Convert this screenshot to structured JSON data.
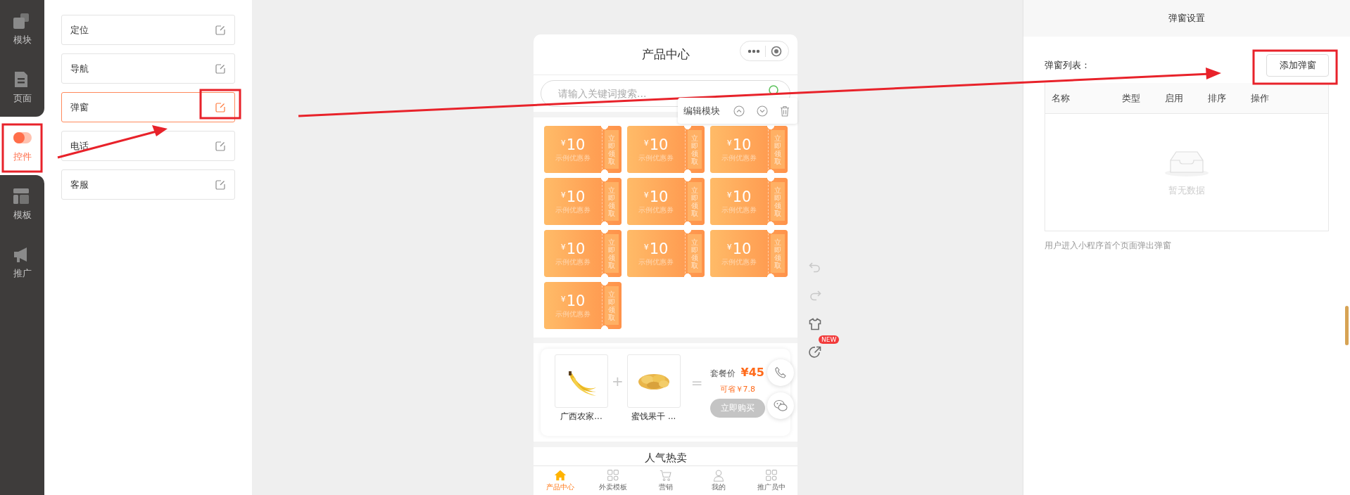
{
  "sidebar": {
    "items": [
      {
        "label": "模块",
        "kind": "blocks",
        "selected": false
      },
      {
        "label": "页面",
        "kind": "page",
        "selected": false
      },
      {
        "label": "控件",
        "kind": "widget",
        "selected": true
      },
      {
        "label": "模板",
        "kind": "template",
        "selected": false
      },
      {
        "label": "推广",
        "kind": "promote",
        "selected": false
      }
    ]
  },
  "widget_panel": {
    "items": [
      {
        "label": "定位",
        "selected": false
      },
      {
        "label": "导航",
        "selected": false
      },
      {
        "label": "弹窗",
        "selected": true
      },
      {
        "label": "电话",
        "selected": false
      },
      {
        "label": "客服",
        "selected": false
      }
    ]
  },
  "phone": {
    "title": "产品中心",
    "search": {
      "placeholder": "请输入关键词搜索..."
    },
    "module_toolbar": {
      "label": "编辑模块"
    },
    "coupons": [
      {
        "currency": "¥",
        "amount": "10",
        "name": "示例优惠券",
        "action": "立即领取"
      },
      {
        "currency": "¥",
        "amount": "10",
        "name": "示例优惠券",
        "action": "立即领取"
      },
      {
        "currency": "¥",
        "amount": "10",
        "name": "示例优惠券",
        "action": "立即领取"
      },
      {
        "currency": "¥",
        "amount": "10",
        "name": "示例优惠券",
        "action": "立即领取"
      },
      {
        "currency": "¥",
        "amount": "10",
        "name": "示例优惠券",
        "action": "立即领取"
      },
      {
        "currency": "¥",
        "amount": "10",
        "name": "示例优惠券",
        "action": "立即领取"
      },
      {
        "currency": "¥",
        "amount": "10",
        "name": "示例优惠券",
        "action": "立即领取"
      },
      {
        "currency": "¥",
        "amount": "10",
        "name": "示例优惠券",
        "action": "立即领取"
      },
      {
        "currency": "¥",
        "amount": "10",
        "name": "示例优惠券",
        "action": "立即领取"
      },
      {
        "currency": "¥",
        "amount": "10",
        "name": "示例优惠券",
        "action": "立即领取"
      }
    ],
    "combo": {
      "products": [
        {
          "name": "广西农家...",
          "kind": "picture"
        },
        {
          "name": "蜜饯果干 ...",
          "kind": "picture"
        }
      ],
      "plus": "+",
      "equals": "=",
      "price_label": "套餐价",
      "price": "¥45",
      "saving": "可省￥7.8",
      "button": {
        "label": "立即购买",
        "disabled": true
      }
    },
    "section_title": "人气热卖",
    "tabbar": [
      {
        "label": "产品中心",
        "kind": "home",
        "selected": true
      },
      {
        "label": "外卖模板",
        "kind": "grid",
        "selected": false
      },
      {
        "label": "营销",
        "kind": "cart",
        "selected": false
      },
      {
        "label": "我的",
        "kind": "user",
        "selected": false
      },
      {
        "label": "推广员中",
        "kind": "grid",
        "selected": false
      }
    ]
  },
  "side_tools": [
    {
      "kind": "undo",
      "disabled": true
    },
    {
      "kind": "redo",
      "disabled": true
    },
    {
      "kind": "theme",
      "disabled": false
    },
    {
      "kind": "share",
      "disabled": false,
      "badge": "NEW"
    }
  ],
  "settings": {
    "title": "弹窗设置",
    "list_label": "弹窗列表：",
    "add_button": "添加弹窗",
    "table": {
      "columns": [
        "名称",
        "类型",
        "启用",
        "排序",
        "操作"
      ],
      "empty_text": "暂无数据"
    },
    "hint": "用户进入小程序首个页面弹出弹窗"
  }
}
